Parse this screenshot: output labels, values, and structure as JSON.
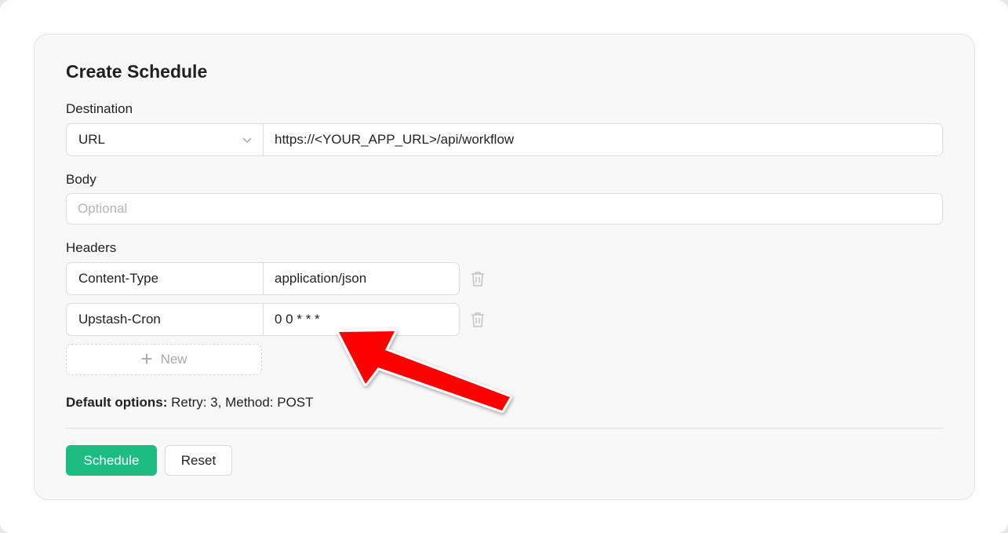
{
  "form": {
    "title": "Create Schedule",
    "destination": {
      "label": "Destination",
      "type_value": "URL",
      "url_value": "https://<YOUR_APP_URL>/api/workflow"
    },
    "body": {
      "label": "Body",
      "placeholder": "Optional"
    },
    "headers": {
      "label": "Headers",
      "rows": [
        {
          "key": "Content-Type",
          "value": "application/json"
        },
        {
          "key": "Upstash-Cron",
          "value": "0 0 * * *"
        }
      ],
      "add_label": "New"
    },
    "defaults": {
      "label": "Default options:",
      "text": "Retry: 3, Method: POST"
    },
    "actions": {
      "submit_label": "Schedule",
      "reset_label": "Reset"
    }
  },
  "annotation": {
    "arrow_color": "#ff0000",
    "arrow_target": "cron-value-field"
  },
  "colors": {
    "accent": "#1dbc80"
  },
  "icons": {
    "select": "chevron-down-icon",
    "delete": "trash-icon",
    "add": "plus-icon"
  }
}
